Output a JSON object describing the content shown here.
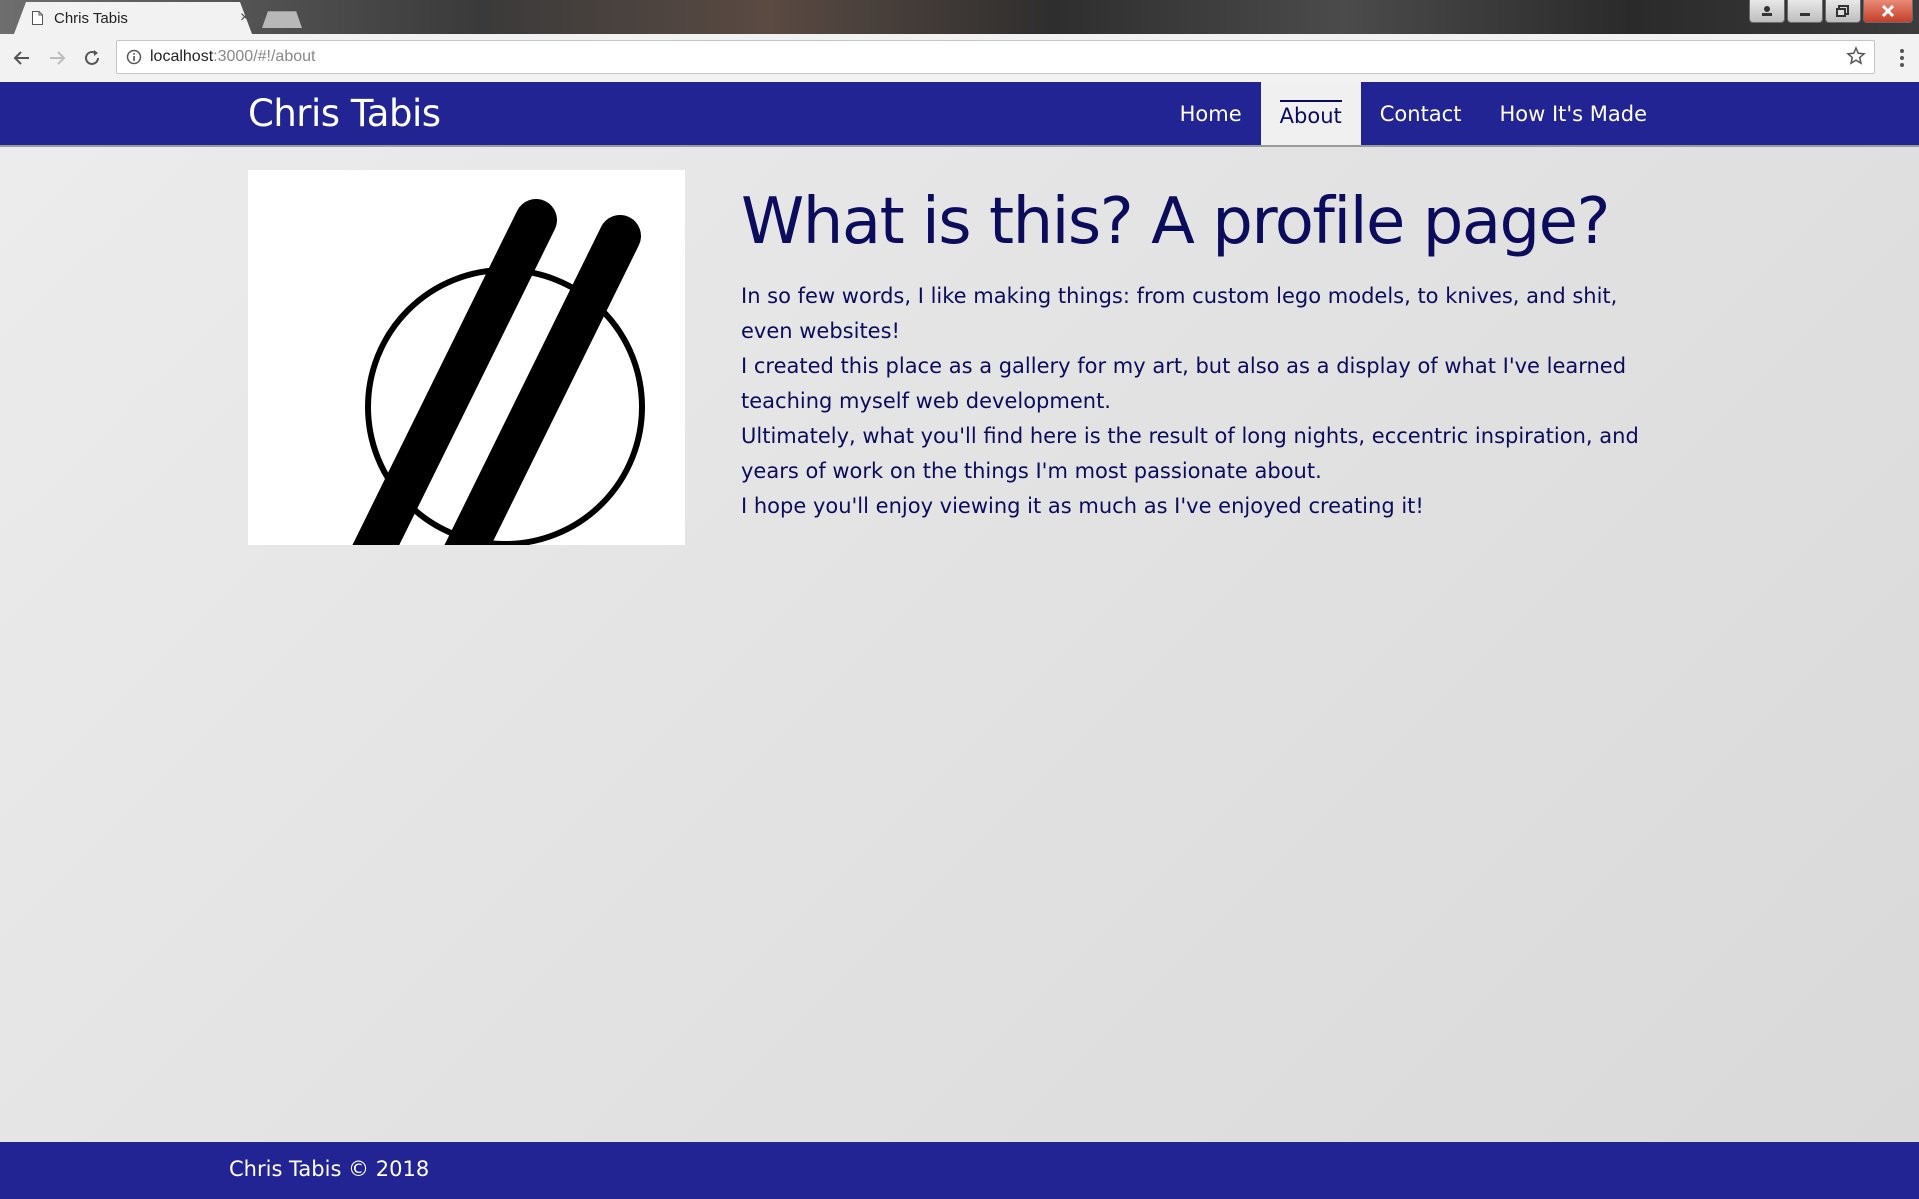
{
  "browser": {
    "tab_title": "Chris Tabis",
    "tab_close": "×",
    "url_host": "localhost",
    "url_rest": ":3000/#!/about"
  },
  "header": {
    "brand": "Chris Tabis",
    "nav": [
      {
        "label": "Home",
        "active": false
      },
      {
        "label": "About",
        "active": true
      },
      {
        "label": "Contact",
        "active": false
      },
      {
        "label": "How It's Made",
        "active": false
      }
    ]
  },
  "main": {
    "headline": "What is this? A profile page?",
    "paragraphs": [
      "In so few words, I like making things: from custom lego models, to knives, and shit, even websites!",
      "I created this place as a gallery for my art, but also as a display of what I've learned teaching myself web development.",
      "Ultimately, what you'll find here is the result of long nights, eccentric inspiration, and years of work on the things I'm most passionate about.",
      "I hope you'll enjoy viewing it as much as I've enjoyed creating it!"
    ]
  },
  "footer": {
    "text": "Chris Tabis © 2018"
  },
  "colors": {
    "header_bg": "#232494",
    "text_primary": "#0c0c5c",
    "active_nav_bg": "#f0f0f0"
  }
}
